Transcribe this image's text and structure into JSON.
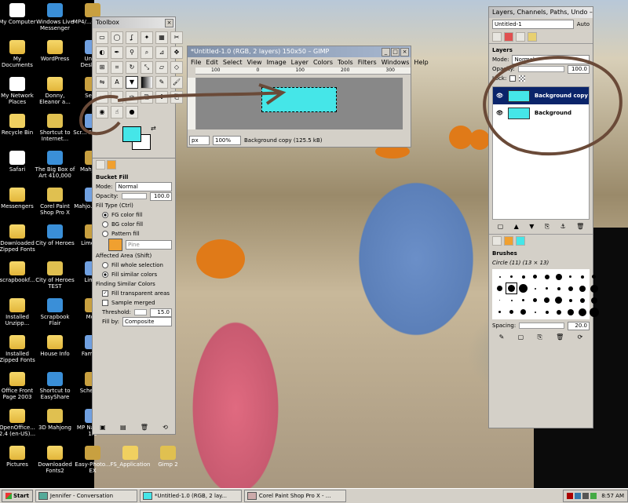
{
  "desktop_icons": [
    {
      "label": "My Computer",
      "x": 0,
      "y": 0
    },
    {
      "label": "Windows Live Messenger",
      "x": 1,
      "y": 0
    },
    {
      "label": "MP4/...On-sc...",
      "x": 2,
      "y": 0
    },
    {
      "label": "My Documents",
      "x": 0,
      "y": 1
    },
    {
      "label": "WordPress",
      "x": 1,
      "y": 1
    },
    {
      "label": "Unti... Deskto...",
      "x": 2,
      "y": 1
    },
    {
      "label": "My Network Places",
      "x": 0,
      "y": 2
    },
    {
      "label": "Donny, Eleanor a...",
      "x": 1,
      "y": 2
    },
    {
      "label": "Sea...",
      "x": 2,
      "y": 2
    },
    {
      "label": "Recycle Bin",
      "x": 0,
      "y": 3
    },
    {
      "label": "Shortcut to Internet...",
      "x": 1,
      "y": 3
    },
    {
      "label": "Scr... Flair W...",
      "x": 2,
      "y": 3
    },
    {
      "label": "Safari",
      "x": 0,
      "y": 4
    },
    {
      "label": "The Big Box of Art 410,000",
      "x": 1,
      "y": 4
    },
    {
      "label": "Mahjon...",
      "x": 2,
      "y": 4
    },
    {
      "label": "Messengers",
      "x": 0,
      "y": 5
    },
    {
      "label": "Corel Paint Shop Pro X",
      "x": 1,
      "y": 5
    },
    {
      "label": "Mahjo... 1.4...",
      "x": 2,
      "y": 5
    },
    {
      "label": "Downloaded Zipped Fonts",
      "x": 0,
      "y": 6
    },
    {
      "label": "City of Heroes",
      "x": 1,
      "y": 6
    },
    {
      "label": "LimeW...",
      "x": 2,
      "y": 6
    },
    {
      "label": "scrapbookf...",
      "x": 0,
      "y": 7
    },
    {
      "label": "City of Heroes TEST",
      "x": 1,
      "y": 7
    },
    {
      "label": "Limi...",
      "x": 2,
      "y": 7
    },
    {
      "label": "Installed Unzipp...",
      "x": 0,
      "y": 8
    },
    {
      "label": "Scrapbook Flair",
      "x": 1,
      "y": 8
    },
    {
      "label": "Mo...",
      "x": 2,
      "y": 8
    },
    {
      "label": "Installed Zipped Fonts",
      "x": 0,
      "y": 9
    },
    {
      "label": "House Info",
      "x": 1,
      "y": 9
    },
    {
      "label": "Family...",
      "x": 2,
      "y": 9
    },
    {
      "label": "Office Front Page 2003",
      "x": 0,
      "y": 10
    },
    {
      "label": "Shortcut to EasyShare",
      "x": 1,
      "y": 10
    },
    {
      "label": "Schedu...",
      "x": 2,
      "y": 10
    },
    {
      "label": "OpenOffice... 2.4 (en-US)...",
      "x": 0,
      "y": 11
    },
    {
      "label": "3D Mahjong",
      "x": 1,
      "y": 11
    },
    {
      "label": "MP Na... EX 1.0",
      "x": 2,
      "y": 11
    },
    {
      "label": "Pictures",
      "x": 0,
      "y": 12
    },
    {
      "label": "Downloaded Fonts2",
      "x": 1,
      "y": 12
    },
    {
      "label": "Easy-Photo... EX",
      "x": 2,
      "y": 12
    },
    {
      "label": "FS_Application",
      "x": 3,
      "y": 12
    },
    {
      "label": "Gimp 2",
      "x": 4,
      "y": 12
    }
  ],
  "toolbox": {
    "title": "Toolbox",
    "tool_name": "Bucket Fill",
    "mode_label": "Mode:",
    "mode_value": "Normal",
    "opacity_label": "Opacity:",
    "opacity_value": "100.0",
    "fill_type_label": "Fill Type  (Ctrl)",
    "fg_fill": "FG color fill",
    "bg_fill": "BG color fill",
    "pattern_fill": "Pattern fill",
    "pattern_name": "Pine",
    "affected_label": "Affected Area  (Shift)",
    "fill_whole": "Fill whole selection",
    "fill_similar": "Fill similar colors",
    "finding_label": "Finding Similar Colors",
    "fill_transparent": "Fill transparent areas",
    "sample_merged": "Sample merged",
    "threshold_label": "Threshold:",
    "threshold_value": "15.0",
    "fillby_label": "Fill by:",
    "fillby_value": "Composite",
    "fg_color": "#45e6e8",
    "bg_color": "#ffffff",
    "pattern_color": "#f0a030"
  },
  "image_window": {
    "title": "*Untitled-1.0 (RGB, 2 layers) 150x50 – GIMP",
    "menus": [
      "File",
      "Edit",
      "Select",
      "View",
      "Image",
      "Layer",
      "Colors",
      "Tools",
      "Filters",
      "Windows",
      "Help"
    ],
    "ruler_marks": [
      "100",
      "0",
      "100",
      "200",
      "300"
    ],
    "unit": "px",
    "zoom": "100%",
    "status": "Background copy (125.5 kB)",
    "canvas_color": "#45e6e8"
  },
  "layers_dialog": {
    "title": "Layers, Channels, Paths, Undo – B...",
    "image_selector": "Untitled-1",
    "auto_label": "Auto",
    "section": "Layers",
    "mode_label": "Mode:",
    "mode_value": "Normal",
    "opacity_label": "Opacity:",
    "opacity_value": "100.0",
    "lock_label": "Lock:",
    "layers": [
      {
        "name": "Background copy",
        "selected": true
      },
      {
        "name": "Background",
        "selected": false
      }
    ]
  },
  "brushes_dialog": {
    "title": "Brushes",
    "selected_brush": "Circle (11) (13 × 13)",
    "spacing_label": "Spacing:",
    "spacing_value": "20.0"
  },
  "taskbar": {
    "start_label": "Start",
    "tasks": [
      "Jennifer - Conversation",
      "*Untitled-1.0 (RGB, 2 lay...",
      "Corel Paint Shop Pro X - ..."
    ],
    "clock": "8:57 AM"
  }
}
